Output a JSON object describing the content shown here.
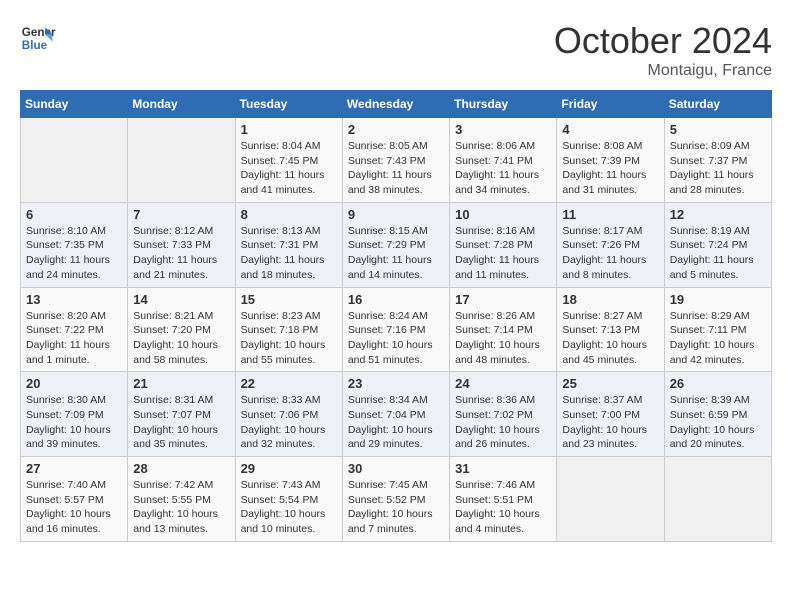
{
  "header": {
    "logo_line1": "General",
    "logo_line2": "Blue",
    "month": "October 2024",
    "location": "Montaigu, France"
  },
  "weekdays": [
    "Sunday",
    "Monday",
    "Tuesday",
    "Wednesday",
    "Thursday",
    "Friday",
    "Saturday"
  ],
  "weeks": [
    [
      {
        "day": "",
        "sunrise": "",
        "sunset": "",
        "daylight": ""
      },
      {
        "day": "",
        "sunrise": "",
        "sunset": "",
        "daylight": ""
      },
      {
        "day": "1",
        "sunrise": "Sunrise: 8:04 AM",
        "sunset": "Sunset: 7:45 PM",
        "daylight": "Daylight: 11 hours and 41 minutes."
      },
      {
        "day": "2",
        "sunrise": "Sunrise: 8:05 AM",
        "sunset": "Sunset: 7:43 PM",
        "daylight": "Daylight: 11 hours and 38 minutes."
      },
      {
        "day": "3",
        "sunrise": "Sunrise: 8:06 AM",
        "sunset": "Sunset: 7:41 PM",
        "daylight": "Daylight: 11 hours and 34 minutes."
      },
      {
        "day": "4",
        "sunrise": "Sunrise: 8:08 AM",
        "sunset": "Sunset: 7:39 PM",
        "daylight": "Daylight: 11 hours and 31 minutes."
      },
      {
        "day": "5",
        "sunrise": "Sunrise: 8:09 AM",
        "sunset": "Sunset: 7:37 PM",
        "daylight": "Daylight: 11 hours and 28 minutes."
      }
    ],
    [
      {
        "day": "6",
        "sunrise": "Sunrise: 8:10 AM",
        "sunset": "Sunset: 7:35 PM",
        "daylight": "Daylight: 11 hours and 24 minutes."
      },
      {
        "day": "7",
        "sunrise": "Sunrise: 8:12 AM",
        "sunset": "Sunset: 7:33 PM",
        "daylight": "Daylight: 11 hours and 21 minutes."
      },
      {
        "day": "8",
        "sunrise": "Sunrise: 8:13 AM",
        "sunset": "Sunset: 7:31 PM",
        "daylight": "Daylight: 11 hours and 18 minutes."
      },
      {
        "day": "9",
        "sunrise": "Sunrise: 8:15 AM",
        "sunset": "Sunset: 7:29 PM",
        "daylight": "Daylight: 11 hours and 14 minutes."
      },
      {
        "day": "10",
        "sunrise": "Sunrise: 8:16 AM",
        "sunset": "Sunset: 7:28 PM",
        "daylight": "Daylight: 11 hours and 11 minutes."
      },
      {
        "day": "11",
        "sunrise": "Sunrise: 8:17 AM",
        "sunset": "Sunset: 7:26 PM",
        "daylight": "Daylight: 11 hours and 8 minutes."
      },
      {
        "day": "12",
        "sunrise": "Sunrise: 8:19 AM",
        "sunset": "Sunset: 7:24 PM",
        "daylight": "Daylight: 11 hours and 5 minutes."
      }
    ],
    [
      {
        "day": "13",
        "sunrise": "Sunrise: 8:20 AM",
        "sunset": "Sunset: 7:22 PM",
        "daylight": "Daylight: 11 hours and 1 minute."
      },
      {
        "day": "14",
        "sunrise": "Sunrise: 8:21 AM",
        "sunset": "Sunset: 7:20 PM",
        "daylight": "Daylight: 10 hours and 58 minutes."
      },
      {
        "day": "15",
        "sunrise": "Sunrise: 8:23 AM",
        "sunset": "Sunset: 7:18 PM",
        "daylight": "Daylight: 10 hours and 55 minutes."
      },
      {
        "day": "16",
        "sunrise": "Sunrise: 8:24 AM",
        "sunset": "Sunset: 7:16 PM",
        "daylight": "Daylight: 10 hours and 51 minutes."
      },
      {
        "day": "17",
        "sunrise": "Sunrise: 8:26 AM",
        "sunset": "Sunset: 7:14 PM",
        "daylight": "Daylight: 10 hours and 48 minutes."
      },
      {
        "day": "18",
        "sunrise": "Sunrise: 8:27 AM",
        "sunset": "Sunset: 7:13 PM",
        "daylight": "Daylight: 10 hours and 45 minutes."
      },
      {
        "day": "19",
        "sunrise": "Sunrise: 8:29 AM",
        "sunset": "Sunset: 7:11 PM",
        "daylight": "Daylight: 10 hours and 42 minutes."
      }
    ],
    [
      {
        "day": "20",
        "sunrise": "Sunrise: 8:30 AM",
        "sunset": "Sunset: 7:09 PM",
        "daylight": "Daylight: 10 hours and 39 minutes."
      },
      {
        "day": "21",
        "sunrise": "Sunrise: 8:31 AM",
        "sunset": "Sunset: 7:07 PM",
        "daylight": "Daylight: 10 hours and 35 minutes."
      },
      {
        "day": "22",
        "sunrise": "Sunrise: 8:33 AM",
        "sunset": "Sunset: 7:06 PM",
        "daylight": "Daylight: 10 hours and 32 minutes."
      },
      {
        "day": "23",
        "sunrise": "Sunrise: 8:34 AM",
        "sunset": "Sunset: 7:04 PM",
        "daylight": "Daylight: 10 hours and 29 minutes."
      },
      {
        "day": "24",
        "sunrise": "Sunrise: 8:36 AM",
        "sunset": "Sunset: 7:02 PM",
        "daylight": "Daylight: 10 hours and 26 minutes."
      },
      {
        "day": "25",
        "sunrise": "Sunrise: 8:37 AM",
        "sunset": "Sunset: 7:00 PM",
        "daylight": "Daylight: 10 hours and 23 minutes."
      },
      {
        "day": "26",
        "sunrise": "Sunrise: 8:39 AM",
        "sunset": "Sunset: 6:59 PM",
        "daylight": "Daylight: 10 hours and 20 minutes."
      }
    ],
    [
      {
        "day": "27",
        "sunrise": "Sunrise: 7:40 AM",
        "sunset": "Sunset: 5:57 PM",
        "daylight": "Daylight: 10 hours and 16 minutes."
      },
      {
        "day": "28",
        "sunrise": "Sunrise: 7:42 AM",
        "sunset": "Sunset: 5:55 PM",
        "daylight": "Daylight: 10 hours and 13 minutes."
      },
      {
        "day": "29",
        "sunrise": "Sunrise: 7:43 AM",
        "sunset": "Sunset: 5:54 PM",
        "daylight": "Daylight: 10 hours and 10 minutes."
      },
      {
        "day": "30",
        "sunrise": "Sunrise: 7:45 AM",
        "sunset": "Sunset: 5:52 PM",
        "daylight": "Daylight: 10 hours and 7 minutes."
      },
      {
        "day": "31",
        "sunrise": "Sunrise: 7:46 AM",
        "sunset": "Sunset: 5:51 PM",
        "daylight": "Daylight: 10 hours and 4 minutes."
      },
      {
        "day": "",
        "sunrise": "",
        "sunset": "",
        "daylight": ""
      },
      {
        "day": "",
        "sunrise": "",
        "sunset": "",
        "daylight": ""
      }
    ]
  ]
}
